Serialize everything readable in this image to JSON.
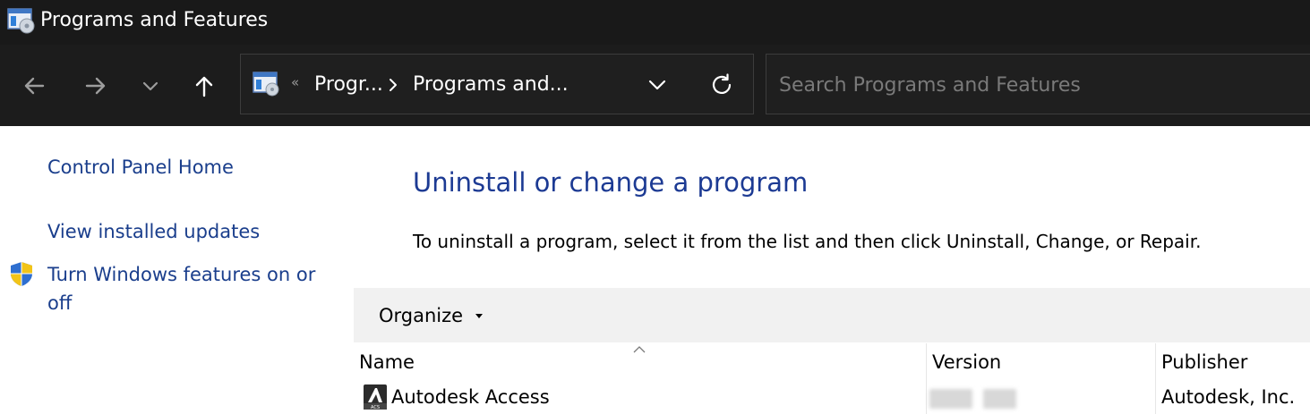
{
  "window": {
    "title": "Programs and Features",
    "icon": "programs-features-icon"
  },
  "nav": {
    "back_icon": "arrow-left-icon",
    "forward_icon": "arrow-right-icon",
    "recent_icon": "chevron-down-icon",
    "up_icon": "arrow-up-icon"
  },
  "address": {
    "overflow": "«",
    "crumbs": [
      "Progr...",
      "Programs and..."
    ],
    "dropdown_icon": "chevron-down-icon",
    "refresh_icon": "refresh-icon"
  },
  "search": {
    "placeholder": "Search Programs and Features",
    "value": ""
  },
  "sidebar": {
    "items": [
      {
        "label": "Control Panel Home"
      },
      {
        "label": "View installed updates"
      },
      {
        "label": "Turn Windows features on or off",
        "line1": "Turn Windows features on or",
        "line2": "off",
        "icon": "shield-icon"
      }
    ]
  },
  "main": {
    "title": "Uninstall or change a program",
    "instructions": "To uninstall a program, select it from the list and then click Uninstall, Change, or Repair.",
    "organize_label": "Organize"
  },
  "table": {
    "columns": [
      "Name",
      "Version",
      "Publisher"
    ],
    "sorted_column": "Name",
    "rows": [
      {
        "name": "Autodesk Access",
        "version": "",
        "publisher": "Autodesk, Inc.",
        "icon": "autodesk-access-icon"
      }
    ]
  },
  "colors": {
    "titlebar_bg": "#191919",
    "navbar_bg": "#1c1c1c",
    "link": "#1a3e8c",
    "heading": "#1c3a93",
    "toolbar_bg": "#f1f1f1"
  }
}
